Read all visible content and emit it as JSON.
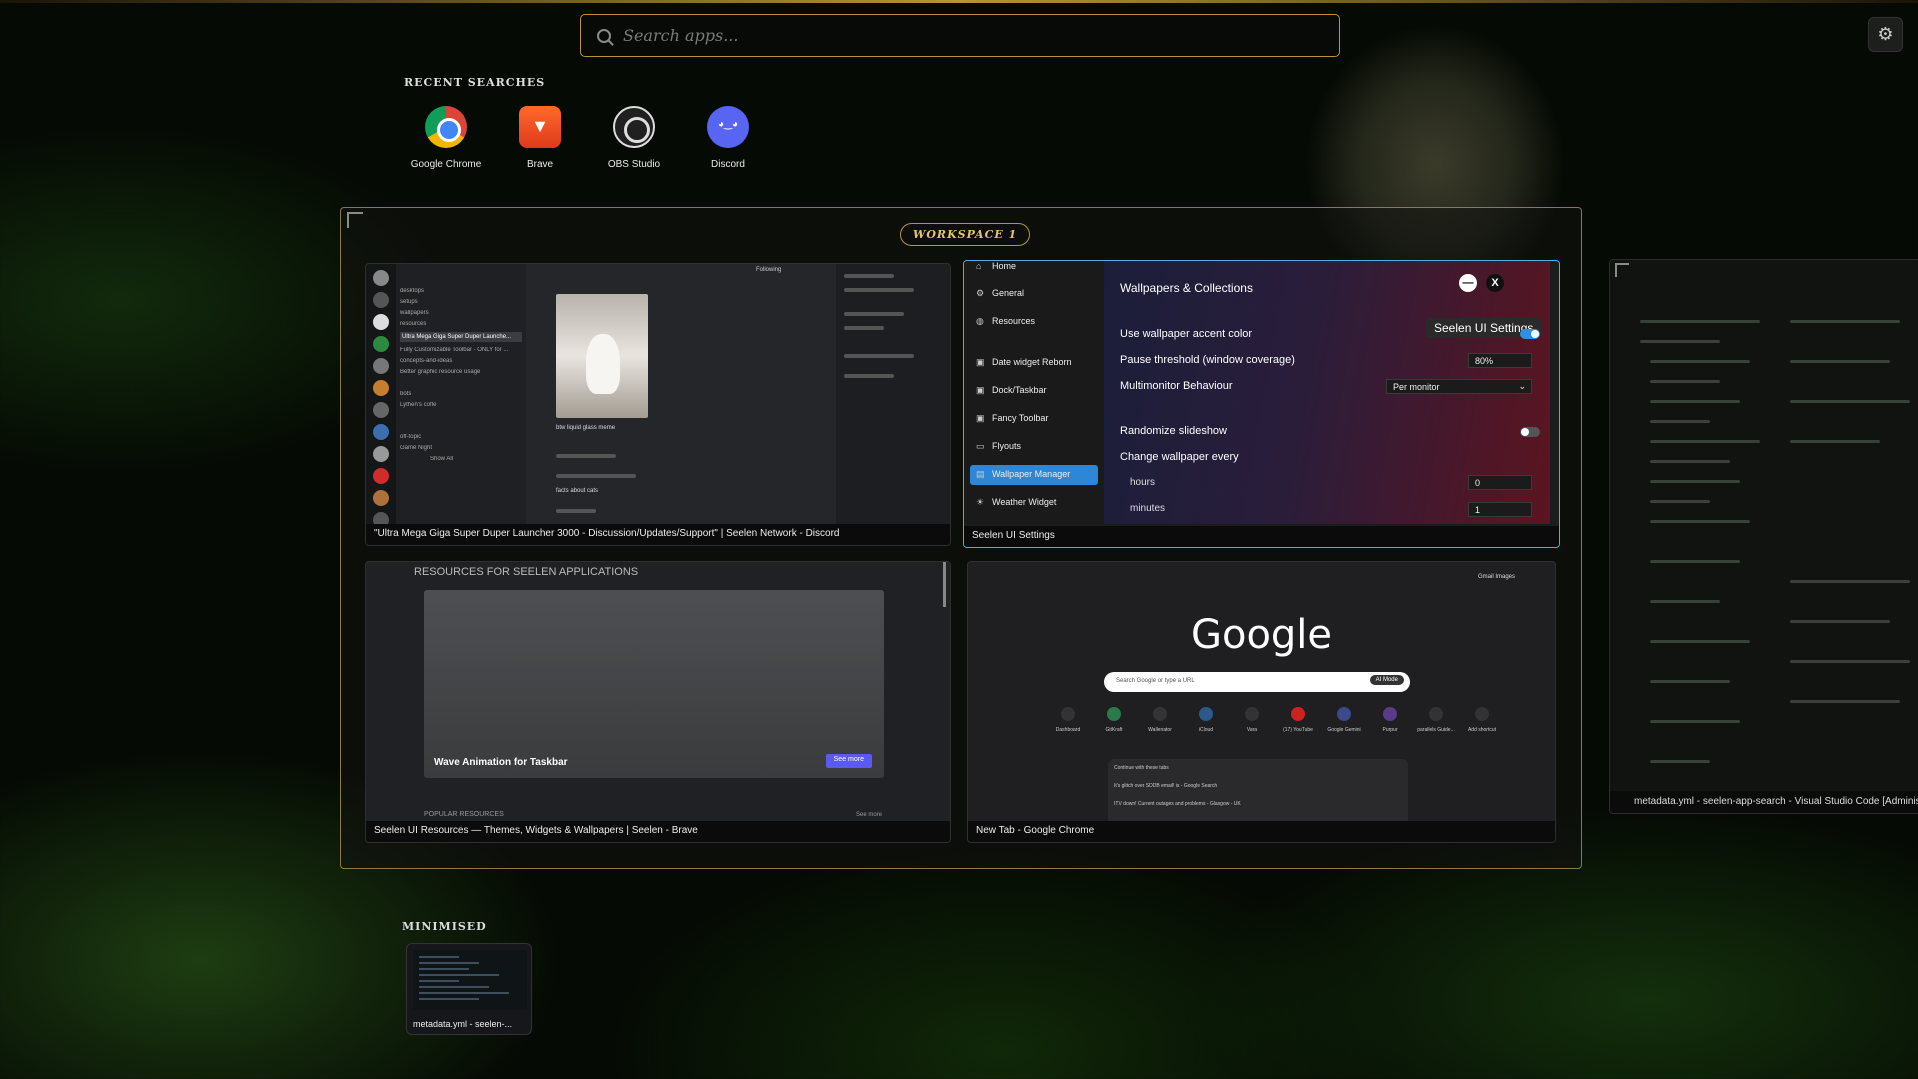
{
  "search": {
    "placeholder": "Search apps..."
  },
  "recent": {
    "title": "RECENT SEARCHES",
    "apps": [
      {
        "label": "Google Chrome",
        "icon": "chrome-icon"
      },
      {
        "label": "Brave",
        "icon": "brave-icon"
      },
      {
        "label": "OBS Studio",
        "icon": "obs-icon"
      },
      {
        "label": "Discord",
        "icon": "discord-icon"
      }
    ]
  },
  "workspace": {
    "label": "WORKSPACE 1",
    "windows": {
      "discord": {
        "caption": "\"Ultra Mega Giga Super Duper Launcher 3000 - Discussion/Updates/Support\" | Seelen Network - Discord",
        "channels": [
          "desktops",
          "setups",
          "wallpapers",
          "resources",
          "Ultra Mega Giga Super Duper Launche...",
          "Fully Customizable Toolbar - ONLY for ...",
          "concepts-and-ideas",
          "Better graphic resource usage",
          "bots",
          "Lythen's coffe",
          "off-topic",
          "Game Night",
          "Show All"
        ],
        "message": "btw liquid glass meme",
        "message2": "facts about cats",
        "header": "Following"
      },
      "settings": {
        "caption": "Seelen UI Settings",
        "nav": [
          "Home",
          "General",
          "Resources",
          "Date widget Reborn",
          "Dock/Taskbar",
          "Fancy Toolbar",
          "Flyouts",
          "Wallpaper Manager",
          "Weather Widget"
        ],
        "heading": "Wallpapers & Collections",
        "tooltip": "Seelen UI Settings",
        "rows": {
          "accent": "Use wallpaper accent color",
          "pause": "Pause threshold (window coverage)",
          "pause_value": "80%",
          "multimonitor": "Multimonitor Behaviour",
          "multimonitor_value": "Per monitor",
          "randomize": "Randomize slideshow",
          "change": "Change wallpaper every",
          "hours": "hours",
          "hours_value": "0",
          "minutes": "minutes",
          "minutes_value": "1"
        },
        "accent_on": true,
        "randomize_on": false
      },
      "brave": {
        "caption": "Seelen UI Resources — Themes, Widgets & Wallpapers | Seelen - Brave",
        "heading": "RESOURCES FOR SEELEN APPLICATIONS",
        "card": "Wave Animation for Taskbar",
        "button": "See more",
        "popular": "POPULAR RESOURCES",
        "see": "See more"
      },
      "chrome": {
        "caption": "New Tab - Google Chrome",
        "top": "Gmail   Images",
        "logo": "Google",
        "search": "Search Google or type a URL",
        "ai": "AI Mode",
        "shortcuts": [
          "Dashboard",
          "GitKraft",
          "Wallenator",
          "iCloud",
          "Vara",
          "(17) YouTube",
          "Google Gemini",
          "Purpur",
          "parallels Guide...",
          "Add shortcut"
        ],
        "card_title": "Continue with these tabs",
        "card_rows": [
          "It's glitch over SDDB email! is - Google Search",
          "ITV down! Current outages and problems - Glasgow - UK"
        ]
      }
    }
  },
  "offscreen": {
    "caption": "metadata.yml - seelen-app-search - Visual Studio Code [Administr..."
  },
  "minimised": {
    "title": "MINIMISED",
    "item": "metadata.yml - seelen-..."
  },
  "colors": {
    "accent_gold": "#b8923c",
    "active_border": "#49b0e6",
    "selected_nav": "#2d87d6"
  }
}
